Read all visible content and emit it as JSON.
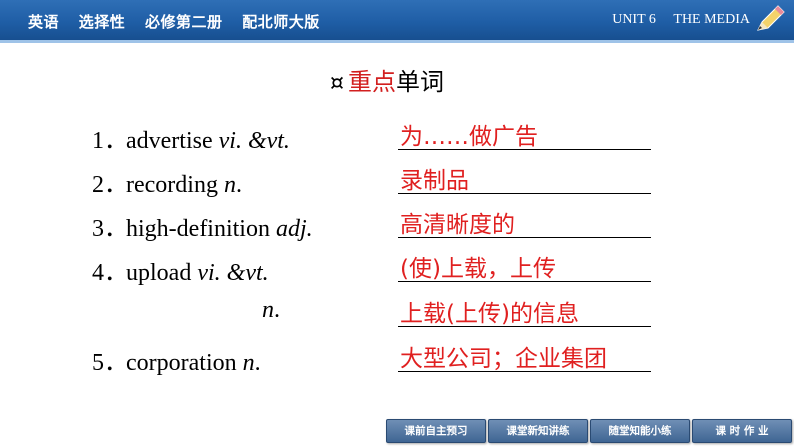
{
  "header": {
    "items": [
      "英语",
      "选择性",
      "必修第二册",
      "配北师大版"
    ],
    "unit": "UNIT 6",
    "unit_title": "THE MEDIA"
  },
  "section": {
    "deco": "¤",
    "title_red": "重点",
    "title_rest": "单词"
  },
  "vocab": [
    {
      "num": "1．",
      "word": "advertise ",
      "pos": "vi. &vt.",
      "tail": "",
      "answer": "为……做广告"
    },
    {
      "num": "2．",
      "word": "recording ",
      "pos": "n",
      "tail": ".",
      "answer": "录制品"
    },
    {
      "num": "3．",
      "word": "high-definition ",
      "pos": "adj.",
      "tail": "",
      "answer": "高清晰度的"
    },
    {
      "num": "4．",
      "word": "upload ",
      "pos": "vi. &vt.",
      "tail": "",
      "answer": "(使)上载，上传"
    },
    {
      "num": "",
      "word": "",
      "pos": "n",
      "tail": ".",
      "answer": "上载(上传)的信息"
    },
    {
      "num": "5．",
      "word": "corporation ",
      "pos": "n",
      "tail": ".",
      "answer": "大型公司；企业集团"
    }
  ],
  "nav": [
    "课前自主预习",
    "课堂新知讲练",
    "随堂知能小练",
    "课 时 作 业"
  ],
  "colors": {
    "header_blue": "#1f5ea6",
    "answer_red": "#e02020",
    "nav_blue": "#4a6e9a"
  }
}
